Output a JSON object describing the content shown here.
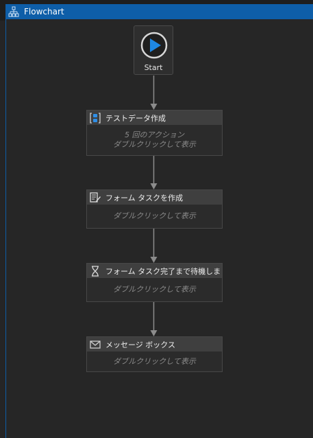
{
  "window": {
    "title": "Flowchart",
    "title_icon": "flowchart-icon"
  },
  "start": {
    "label": "Start",
    "icon": "play-icon"
  },
  "nodes": [
    {
      "title": "テストデータ作成",
      "icon": "variable-icon",
      "body_line1": "5 回のアクション",
      "body_line2": "ダブルクリックして表示"
    },
    {
      "title": "フォーム タスクを作成",
      "icon": "create-task-icon",
      "body_line1": "ダブルクリックして表示"
    },
    {
      "title": "フォーム タスク完了まで待機しま",
      "icon": "hourglass-icon",
      "body_line1": "ダブルクリックして表示"
    },
    {
      "title": "メッセージ ボックス",
      "icon": "envelope-icon",
      "body_line1": "ダブルクリックして表示"
    }
  ],
  "colors": {
    "accent": "#0e5ea8",
    "play": "#1e88e5",
    "canvas": "#262626"
  }
}
